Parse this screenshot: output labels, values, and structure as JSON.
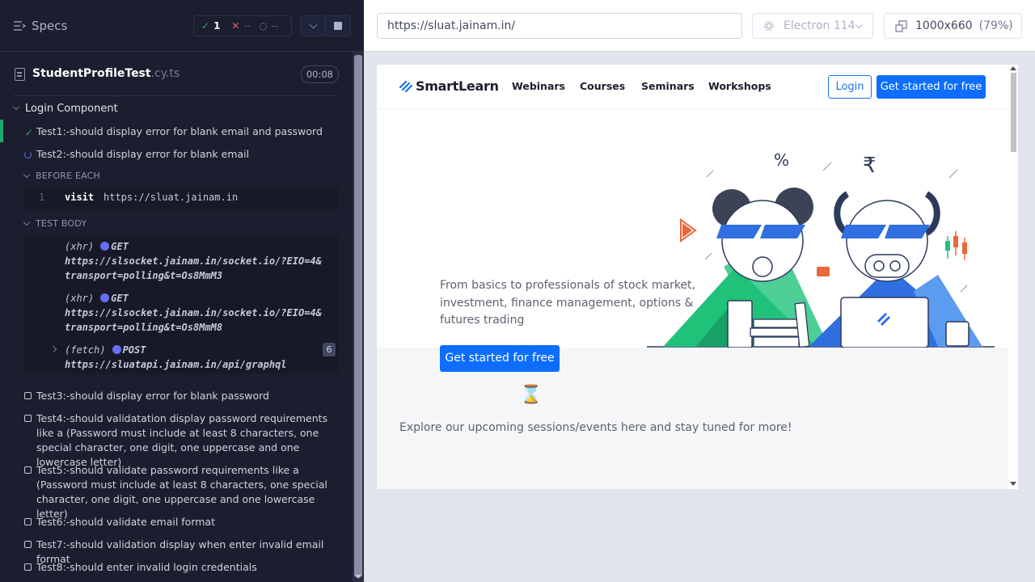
{
  "runner": {
    "header": {
      "title": "Specs"
    },
    "stats": {
      "passed": "1",
      "failed": "--",
      "pending": "--"
    },
    "spec": {
      "name": "StudentProfileTest",
      "ext": ".cy.ts",
      "duration": "00:08"
    },
    "suite": {
      "name": "Login Component"
    },
    "tests": [
      {
        "label": "Test1:-should display error for blank email and password",
        "state": "passed"
      },
      {
        "label": "Test2:-should display error for blank email",
        "state": "running"
      },
      {
        "label": "Test3:-should display error for blank password",
        "state": "pending"
      },
      {
        "label": "Test4:-should validatation display password requirements like a (Password must include at least 8 characters, one special character, one digit, one uppercase and one lowercase letter)",
        "state": "pending"
      },
      {
        "label": "Test5:-should validate password requirements like a (Password must include at least 8 characters, one special character, one digit, one uppercase and one lowercase letter)",
        "state": "pending"
      },
      {
        "label": "Test6:-should validate email format",
        "state": "pending"
      },
      {
        "label": "Test7:-should validation display when enter invalid email format",
        "state": "pending"
      },
      {
        "label": "Test8:-should enter invalid login credentials",
        "state": "pending"
      }
    ],
    "hooks": {
      "before_each": "BEFORE EACH",
      "test_body": "TEST BODY"
    },
    "before_each_cmd": {
      "num": "1",
      "name": "visit",
      "arg": "https://sluat.jainam.in"
    },
    "requests": [
      {
        "kind": "(xhr)",
        "method": "GET",
        "url": "https://slsocket.jainam.in/socket.io/?EIO=4&transport=polling&t=Os8MmM3"
      },
      {
        "kind": "(xhr)",
        "method": "GET",
        "url": "https://slsocket.jainam.in/socket.io/?EIO=4&transport=polling&t=Os8MmM8"
      },
      {
        "kind": "(fetch)",
        "method": "POST",
        "url": "https://sluatapi.jainam.in/api/graphql",
        "count": "6"
      }
    ]
  },
  "browser": {
    "url": "https://sluat.jainam.in/",
    "browser_name": "Electron 114",
    "viewport": "1000x660",
    "zoom": "(79%)"
  },
  "site": {
    "brand": "SmartLearn",
    "nav": [
      "Webinars",
      "Courses",
      "Seminars",
      "Workshops"
    ],
    "login": "Login",
    "cta_nav": "Get started for free",
    "hero_text": "From basics to professionals of stock market, investment, finance management, options & futures trading",
    "cta_hero": "Get started for free",
    "hourglass": "⌛",
    "explore_text": "Explore our upcoming sessions/events here and stay tuned for more!",
    "rupee": "₹",
    "percent": "%"
  },
  "colors": {
    "pass": "#1fa971",
    "fail": "#e45770",
    "accent": "#6470f3",
    "brand_blue": "#0d6efd",
    "green": "#20c27a"
  }
}
